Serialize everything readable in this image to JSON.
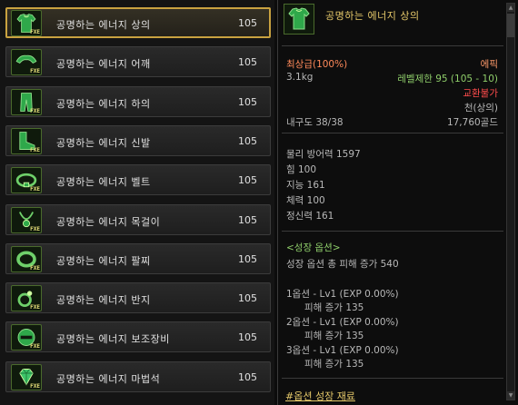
{
  "item_list": [
    {
      "name": "공명하는 에너지 상의",
      "level": "105",
      "icon": "top-armor-icon",
      "fxe": "FXE"
    },
    {
      "name": "공명하는 에너지 어깨",
      "level": "105",
      "icon": "shoulder-armor-icon",
      "fxe": "FXE"
    },
    {
      "name": "공명하는 에너지 하의",
      "level": "105",
      "icon": "pants-armor-icon",
      "fxe": "FXE"
    },
    {
      "name": "공명하는 에너지 신발",
      "level": "105",
      "icon": "boots-icon",
      "fxe": "FXE"
    },
    {
      "name": "공명하는 에너지 벨트",
      "level": "105",
      "icon": "belt-icon",
      "fxe": "FXE"
    },
    {
      "name": "공명하는 에너지 목걸이",
      "level": "105",
      "icon": "necklace-icon",
      "fxe": "FXE"
    },
    {
      "name": "공명하는 에너지 팔찌",
      "level": "105",
      "icon": "bracelet-icon",
      "fxe": "FXE"
    },
    {
      "name": "공명하는 에너지 반지",
      "level": "105",
      "icon": "ring-icon",
      "fxe": "FXE"
    },
    {
      "name": "공명하는 에너지 보조장비",
      "level": "105",
      "icon": "sub-equipment-icon",
      "fxe": "FXE"
    },
    {
      "name": "공명하는 에너지 마법석",
      "level": "105",
      "icon": "magic-stone-icon",
      "fxe": "FXE"
    }
  ],
  "detail": {
    "title": "공명하는 에너지 상의",
    "grade": "최상급(100%)",
    "rarity": "에픽",
    "weight": "3.1kg",
    "level_req": "레벨제한 95 (105 - 10)",
    "trade": "교환불가",
    "material": "천(상의)",
    "durability": "내구도 38/38",
    "price": "17,760골드",
    "stats": [
      "물리 방어력 1597",
      "힘 100",
      "지능 161",
      "체력 100",
      "정신력 161"
    ],
    "growth_header": "<성장 옵션>",
    "growth_total": "성장 옵션 총 피해 증가 540",
    "options": [
      {
        "label": "1옵션 - Lv1 (EXP 0.00%)",
        "effect": "피해 증가 135"
      },
      {
        "label": "2옵션 - Lv1 (EXP 0.00%)",
        "effect": "피해 증가 135"
      },
      {
        "label": "3옵션 - Lv1 (EXP 0.00%)",
        "effect": "피해 증가 135"
      }
    ],
    "footer": "#옵션 성장 재료"
  },
  "colors": {
    "accent_gold": "#e6c96a",
    "epic": "#ff9a6a",
    "green": "#8fce6a",
    "red": "#ff4c4c",
    "selected_border": "#c9a240"
  }
}
